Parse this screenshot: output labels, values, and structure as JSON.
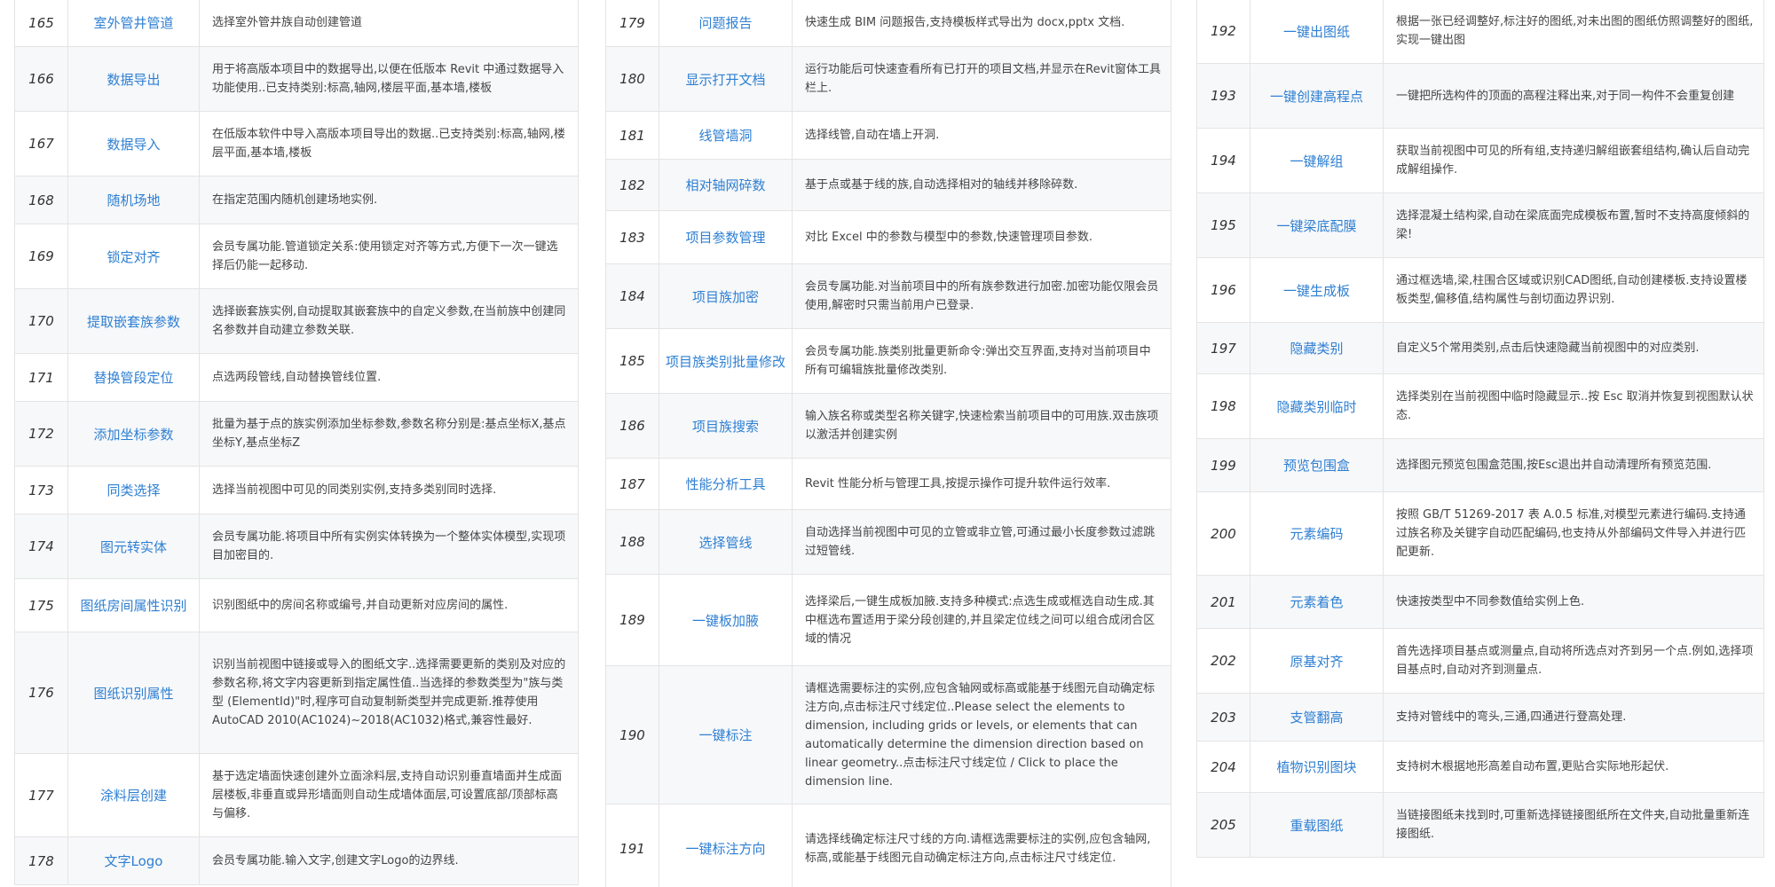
{
  "columns": [
    [
      {
        "no": "165",
        "name": "室外管井管道",
        "desc": "选择室外管井族自动创建管道",
        "h": 54
      },
      {
        "no": "166",
        "name": "数据导出",
        "desc": "用于将高版本项目中的数据导出,以便在低版本 Revit 中通过数据导入功能使用..已支持类别:标高,轴网,楼层平面,基本墙,楼板",
        "h": 73
      },
      {
        "no": "167",
        "name": "数据导入",
        "desc": "在低版本软件中导入高版本项目导出的数据..已支持类别:标高,轴网,楼层平面,基本墙,楼板",
        "h": 73
      },
      {
        "no": "168",
        "name": "随机场地",
        "desc": "在指定范围内随机创建场地实例.",
        "h": 54
      },
      {
        "no": "169",
        "name": "锁定对齐",
        "desc": "会员专属功能.管道锁定关系:使用锁定对齐等方式,方便下一次一键选择后仍能一起移动.",
        "h": 73
      },
      {
        "no": "170",
        "name": "提取嵌套族参数",
        "desc": "选择嵌套族实例,自动提取其嵌套族中的自定义参数,在当前族中创建同名参数并自动建立参数关联.",
        "h": 73
      },
      {
        "no": "171",
        "name": "替换管段定位",
        "desc": "点选两段管线,自动替换管线位置.",
        "h": 54
      },
      {
        "no": "172",
        "name": "添加坐标参数",
        "desc": "批量为基于点的族实例添加坐标参数,参数名称分别是:基点坐标X,基点坐标Y,基点坐标Z",
        "h": 73
      },
      {
        "no": "173",
        "name": "同类选择",
        "desc": "选择当前视图中可见的同类别实例,支持多类别同时选择.",
        "h": 54
      },
      {
        "no": "174",
        "name": "图元转实体",
        "desc": "会员专属功能.将项目中所有实例实体转换为一个整体实体模型,实现项目加密目的.",
        "h": 73
      },
      {
        "no": "175",
        "name": "图纸房间属性识别",
        "desc": "识别图纸中的房间名称或编号,并自动更新对应房间的属性.",
        "h": 60
      },
      {
        "no": "176",
        "name": "图纸识别属性",
        "desc": "识别当前视图中链接或导入的图纸文字..选择需要更新的类别及对应的参数名称,将文字内容更新到指定属性值..当选择的参数类型为\"族与类型 (ElementId)\"时,程序可自动复制新类型并完成更新.推荐使用 AutoCAD 2010(AC1024)~2018(AC1032)格式,兼容性最好.",
        "h": 137
      },
      {
        "no": "177",
        "name": "涂料层创建",
        "desc": "基于选定墙面快速创建外立面涂料层,支持自动识别垂直墙面并生成面层楼板,非垂直或异形墙面则自动生成墙体面层,可设置底部/顶部标高与偏移.",
        "h": 94
      },
      {
        "no": "178",
        "name": "文字Logo",
        "desc": "会员专属功能.输入文字,创建文字Logo的边界线.",
        "h": 54
      }
    ],
    [
      {
        "no": "179",
        "name": "问题报告",
        "desc": "快速生成 BIM 问题报告,支持模板样式导出为 docx,pptx 文档.",
        "h": 54
      },
      {
        "no": "180",
        "name": "显示打开文档",
        "desc": "运行功能后可快速查看所有已打开的项目文档,并显示在Revit窗体工具栏上.",
        "h": 73
      },
      {
        "no": "181",
        "name": "线管墙洞",
        "desc": "选择线管,自动在墙上开洞.",
        "h": 54
      },
      {
        "no": "182",
        "name": "相对轴网碎数",
        "desc": "基于点或基于线的族,自动选择相对的轴线并移除碎数.",
        "h": 58
      },
      {
        "no": "183",
        "name": "项目参数管理",
        "desc": "对比 Excel 中的参数与模型中的参数,快速管理项目参数.",
        "h": 60
      },
      {
        "no": "184",
        "name": "项目族加密",
        "desc": "会员专属功能.对当前项目中的所有族参数进行加密.加密功能仅限会员使用,解密时只需当前用户已登录.",
        "h": 73
      },
      {
        "no": "185",
        "name": "项目族类别批量修改",
        "desc": "会员专属功能.族类别批量更新命令:弹出交互界面,支持对当前项目中所有可编辑族批量修改类别.",
        "h": 73
      },
      {
        "no": "186",
        "name": "项目族搜索",
        "desc": "输入族名称或类型名称关键字,快速检索当前项目中的可用族.双击族项以激活并创建实例",
        "h": 73
      },
      {
        "no": "187",
        "name": "性能分析工具",
        "desc": "Revit 性能分析与管理工具,按提示操作可提升软件运行效率.",
        "h": 58
      },
      {
        "no": "188",
        "name": "选择管线",
        "desc": "自动选择当前视图中可见的立管或非立管,可通过最小长度参数过滤跳过短管线.",
        "h": 73
      },
      {
        "no": "189",
        "name": "一键板加腋",
        "desc": "选择梁后,一键生成板加腋.支持多种模式:点选生成或框选自动生成.其中框选布置适用于梁分段创建的,并且梁定位线之间可以组合成闭合区域的情况",
        "h": 103
      },
      {
        "no": "190",
        "name": "一键标注",
        "desc": "请框选需要标注的实例,应包含轴网或标高或能基于线图元自动确定标注方向,点击标注尺寸线定位..Please select the elements to dimension, including grids or levels, or elements that can automatically determine the dimension direction based on linear geometry..点击标注尺寸线定位 / Click to place the dimension line.",
        "h": 156
      },
      {
        "no": "191",
        "name": "一键标注方向",
        "desc": "请选择线确定标注尺寸线的方向.请框选需要标注的实例,应包含轴网,标高,或能基于线图元自动确定标注方向,点击标注尺寸线定位.",
        "h": 100
      }
    ],
    [
      {
        "no": "192",
        "name": "一键出图纸",
        "desc": "根据一张已经调整好,标注好的图纸,对未出图的图纸仿照调整好的图纸,实现一键出图",
        "h": 73
      },
      {
        "no": "193",
        "name": "一键创建高程点",
        "desc": "一键把所选构件的顶面的高程注释出来,对于同一构件不会重复创建",
        "h": 73
      },
      {
        "no": "194",
        "name": "一键解组",
        "desc": "获取当前视图中可见的所有组,支持递归解组嵌套组结构,确认后自动完成解组操作.",
        "h": 73
      },
      {
        "no": "195",
        "name": "一键梁底配膜",
        "desc": "选择混凝土结构梁,自动在梁底面完成模板布置,暂时不支持高度倾斜的梁!",
        "h": 73
      },
      {
        "no": "196",
        "name": "一键生成板",
        "desc": "通过框选墙,梁,柱围合区域或识别CAD图纸,自动创建楼板.支持设置楼板类型,偏移值,结构属性与剖切面边界识别.",
        "h": 73
      },
      {
        "no": "197",
        "name": "隐藏类别",
        "desc": "自定义5个常用类别,点击后快速隐藏当前视图中的对应类别.",
        "h": 58
      },
      {
        "no": "198",
        "name": "隐藏类别临时",
        "desc": "选择类别在当前视图中临时隐藏显示..按 Esc 取消并恢复到视图默认状态.",
        "h": 73
      },
      {
        "no": "199",
        "name": "预览包围盒",
        "desc": "选择图元预览包围盒范围,按Esc退出并自动清理所有预览范围.",
        "h": 60
      },
      {
        "no": "200",
        "name": "元素编码",
        "desc": "按照 GB/T 51269-2017 表 A.0.5 标准,对模型元素进行编码.支持通过族名称及关键字自动匹配编码,也支持从外部编码文件导入并进行匹配更新.",
        "h": 94
      },
      {
        "no": "201",
        "name": "元素着色",
        "desc": "快速按类型中不同参数值给实例上色.",
        "h": 60
      },
      {
        "no": "202",
        "name": "原基对齐",
        "desc": "首先选择项目基点或测量点,自动将所选点对齐到另一个点.例如,选择项目基点时,自动对齐到测量点.",
        "h": 73
      },
      {
        "no": "203",
        "name": "支管翻高",
        "desc": "支持对管线中的弯头,三通,四通进行登高处理.",
        "h": 54
      },
      {
        "no": "204",
        "name": "植物识别图块",
        "desc": "支持树木根据地形高差自动布置,更贴合实际地形起伏.",
        "h": 58
      },
      {
        "no": "205",
        "name": "重载图纸",
        "desc": "当链接图纸未找到时,可重新选择链接图纸所在文件夹,自动批量重新连接图纸.",
        "h": 73
      }
    ]
  ],
  "offsets": [
    -2,
    -2,
    -2
  ]
}
